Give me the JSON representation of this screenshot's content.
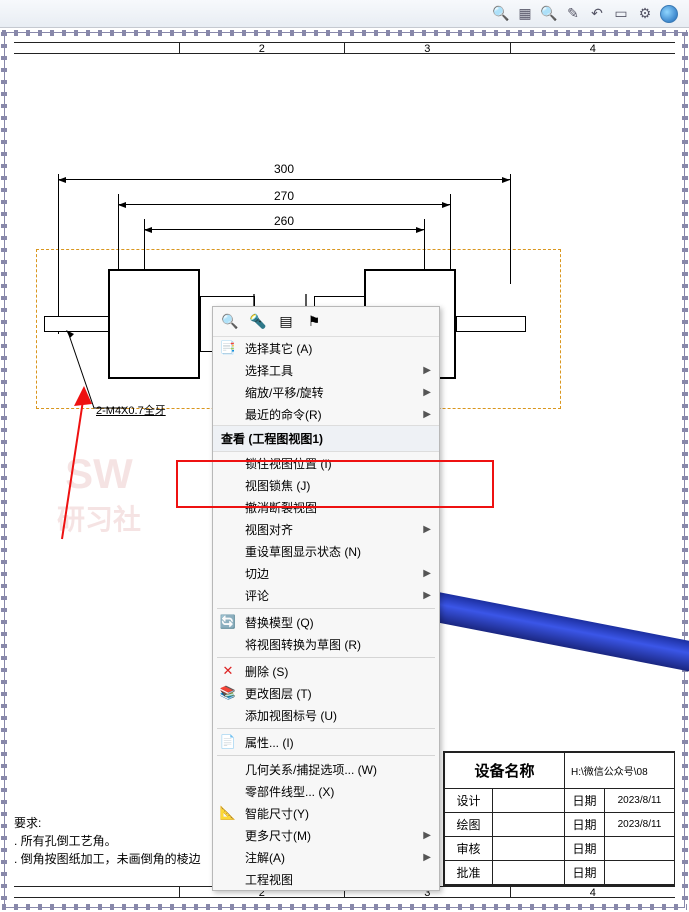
{
  "ruler": {
    "c2": "2",
    "c3": "3",
    "c4": "4"
  },
  "dims": {
    "d300": "300",
    "d270": "270",
    "d260": "260"
  },
  "leader_note": "2-M4X0.7全牙",
  "watermark": {
    "top": "SW",
    "bot": "研习社"
  },
  "notes": {
    "title": "要求:",
    "l1": ". 所有孔倒工艺角。",
    "l2": ". 倒角按图纸加工，未画倒角的棱边"
  },
  "title_block": {
    "name_label": "设备名称",
    "path": "H:\\微信公众号\\08",
    "r1a": "设计",
    "r1b": "日期",
    "r1c": "2023/8/11",
    "r2a": "绘图",
    "r2b": "日期",
    "r2c": "2023/8/11",
    "r3a": "审核",
    "r3b": "日期",
    "r4a": "批准",
    "r4b": "日期"
  },
  "menu": {
    "select_other": "选择其它 (A)",
    "select_tools": "选择工具",
    "zoom_pan": "缩放/平移/旋转",
    "recent": "最近的命令(R)",
    "view_group": "查看 (工程图视图1)",
    "lock_pos": "锁住视图位置 (I)",
    "lock_focus": "视图锁焦 (J)",
    "undo_break": "撤消断裂视图",
    "align": "视图对齐",
    "reset_sketch": "重设草图显示状态 (N)",
    "tangent": "切边",
    "comment": "评论",
    "replace_model": "替换模型 (Q)",
    "to_sketch": "将视图转换为草图 (R)",
    "delete": "删除 (S)",
    "change_layer": "更改图层 (T)",
    "add_label": "添加视图标号 (U)",
    "properties": "属性... (I)",
    "geom_rel": "几何关系/捕捉选项... (W)",
    "part_linetype": "零部件线型... (X)",
    "smart_dim": "智能尺寸(Y)",
    "more_dim": "更多尺寸(M)",
    "annotate": "注解(A)",
    "drawing_view": "工程视图"
  }
}
